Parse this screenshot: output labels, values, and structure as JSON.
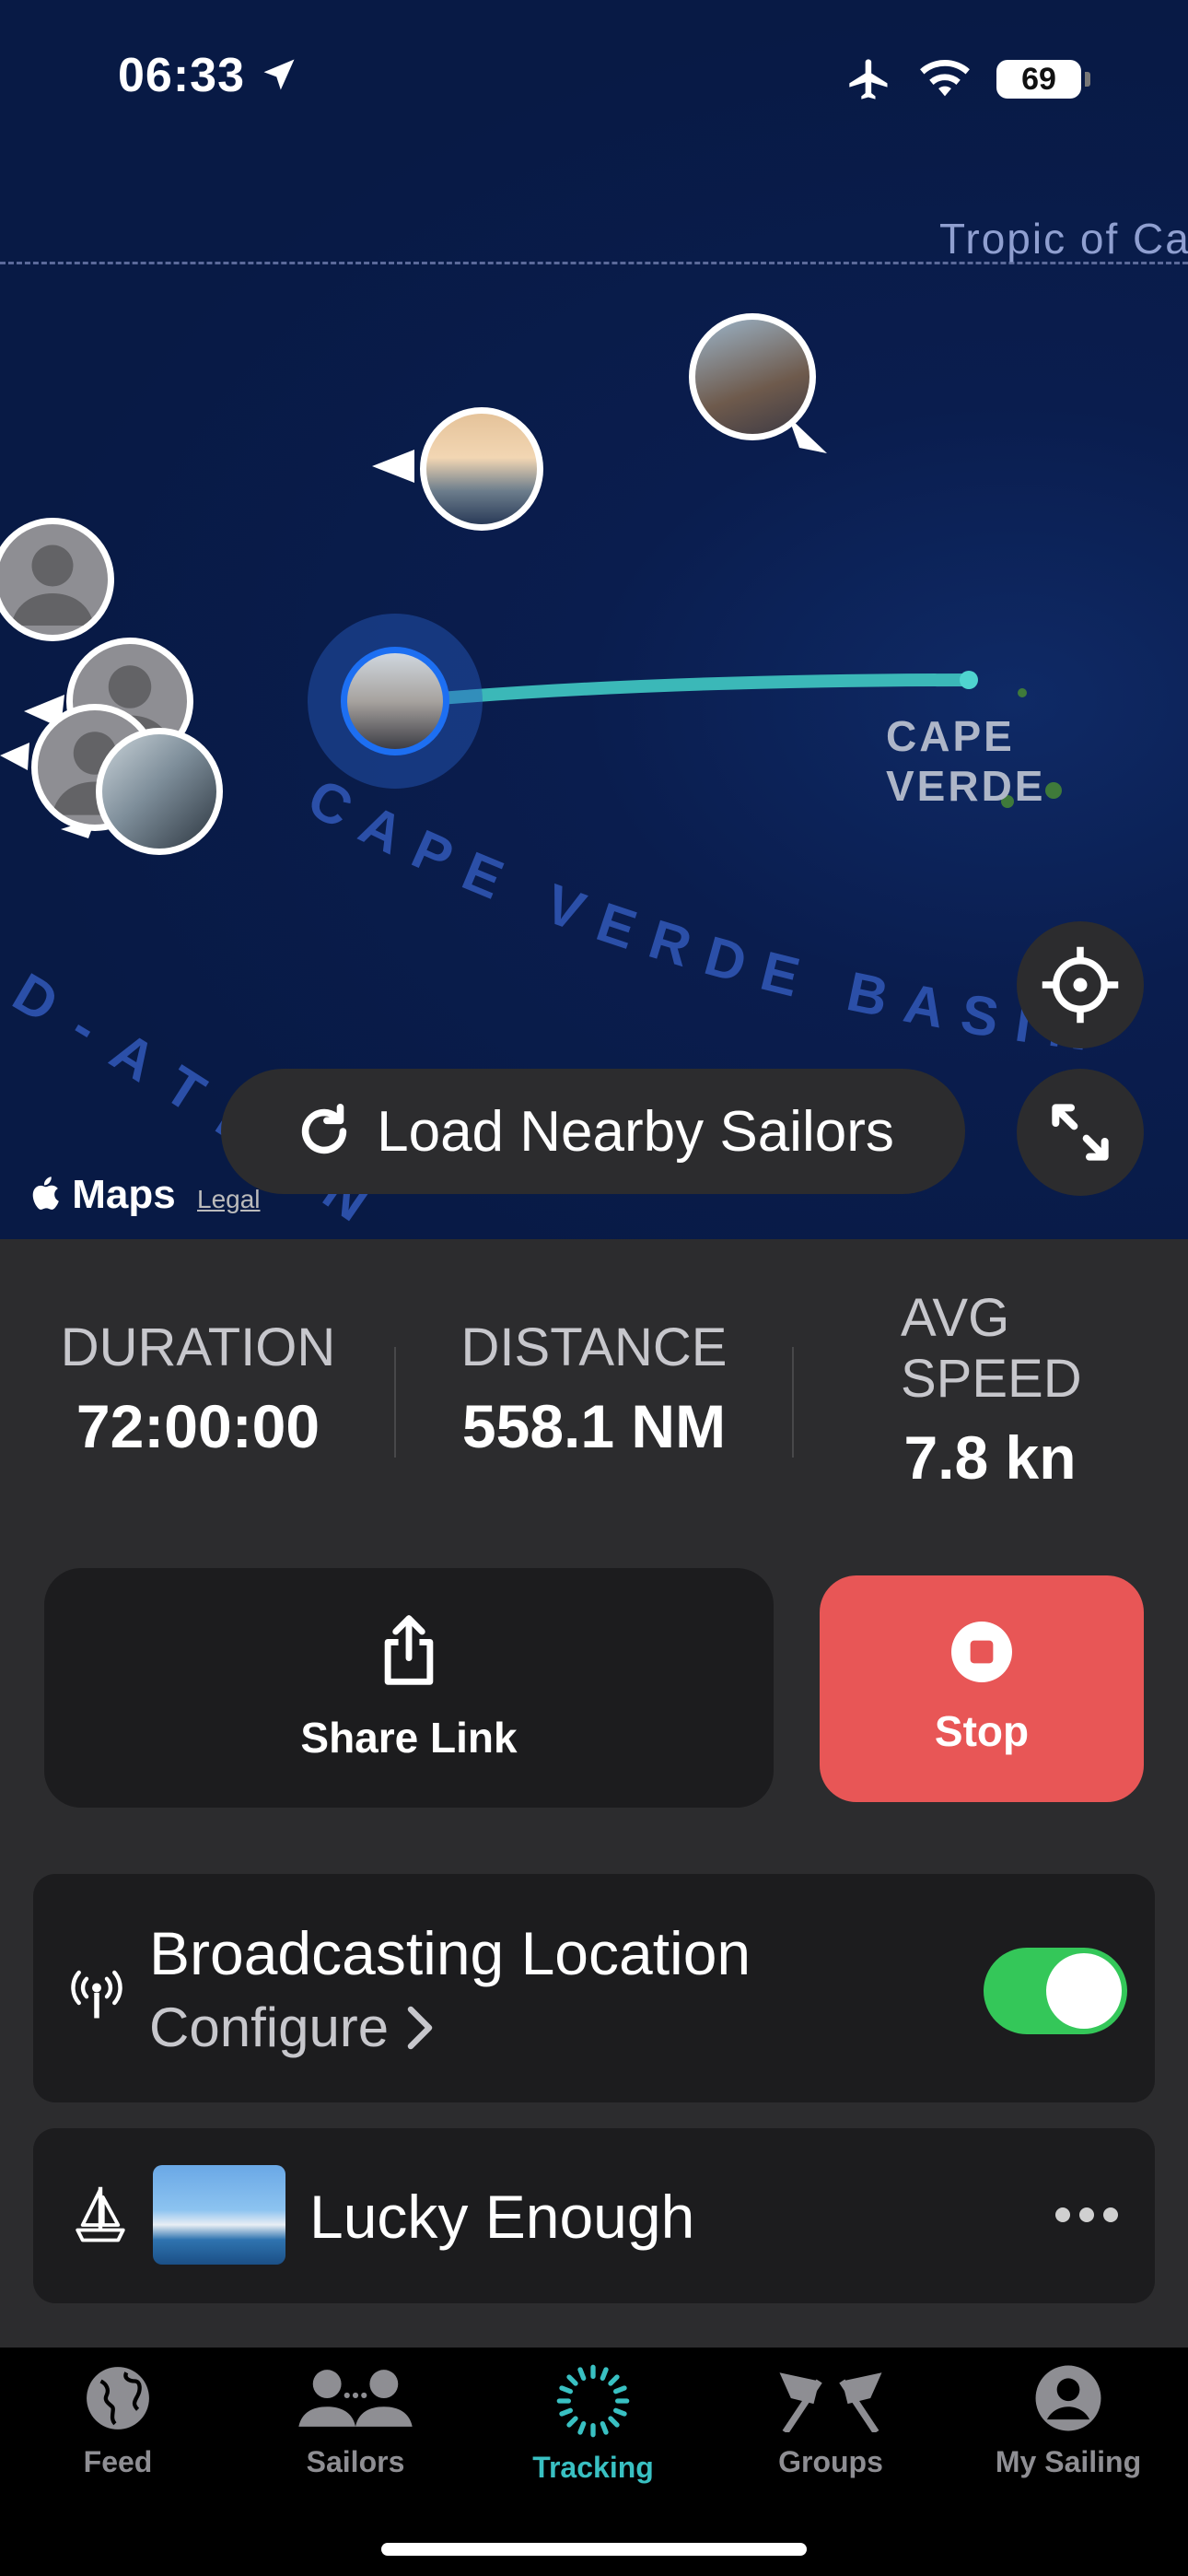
{
  "status": {
    "time": "06:33",
    "battery": "69"
  },
  "map": {
    "tropic_label": "Tropic of Ca",
    "region_label": "CAPE VERDE",
    "basin_label": "CAPE VERDE BASIN",
    "basin_label_2": "D-ATLAN",
    "load_nearby": "Load Nearby Sailors",
    "maps_logo": "Maps",
    "legal": "Legal"
  },
  "stats": {
    "duration": {
      "label": "DURATION",
      "value": "72:00:00"
    },
    "distance": {
      "label": "DISTANCE",
      "value": "558.1 NM"
    },
    "speed": {
      "label_1": "AVG",
      "label_2": "SPEED",
      "value": "7.8 kn"
    }
  },
  "actions": {
    "share": "Share Link",
    "stop": "Stop"
  },
  "broadcast": {
    "title": "Broadcasting Location",
    "subtitle": "Configure",
    "enabled": true
  },
  "boat": {
    "name": "Lucky Enough"
  },
  "tabs": [
    {
      "label": "Feed",
      "icon": "globe-icon"
    },
    {
      "label": "Sailors",
      "icon": "people-icon"
    },
    {
      "label": "Tracking",
      "icon": "tracking-icon",
      "active": true
    },
    {
      "label": "Groups",
      "icon": "flags-icon"
    },
    {
      "label": "My Sailing",
      "icon": "person-icon"
    }
  ],
  "colors": {
    "accent": "#39c0c2",
    "stop": "#e85656",
    "toggle_on": "#34c759",
    "track": "#3bb8b8"
  }
}
